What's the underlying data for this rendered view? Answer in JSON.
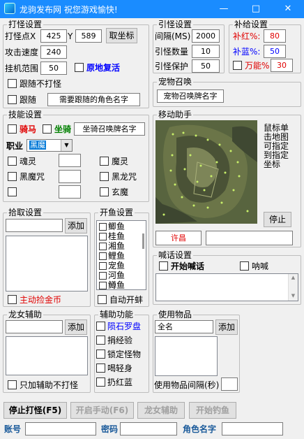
{
  "window": {
    "title": "龙驹发布网 祝您游戏愉快!",
    "min": "—",
    "max": "□",
    "close": "✕"
  },
  "attack": {
    "group": "打怪设置",
    "point_label": "打怪点X",
    "x": "425",
    "y_label": "Y",
    "y": "589",
    "get_coord": "取坐标",
    "speed_label": "攻击速度",
    "speed": "240",
    "range_label": "挂机范围",
    "range": "50",
    "revive_label": "原地复活",
    "follow_no_attack": "跟随不打怪",
    "follow_label": "跟随",
    "follow_name": "需要跟随的角色名字"
  },
  "pull": {
    "group": "引怪设置",
    "interval_label": "间隔(MS)",
    "interval": "2000",
    "count_label": "引怪数量",
    "count": "10",
    "protect_label": "引怪保护",
    "protect": "50"
  },
  "supply": {
    "group": "补给设置",
    "hp_label": "补红%:",
    "hp": "80",
    "mp_label": "补蓝%:",
    "mp": "50",
    "all_label": "万能%",
    "all": "30"
  },
  "pet": {
    "group": "宠物召唤",
    "name": "宠物召唤牌名字"
  },
  "skill": {
    "group": "技能设置",
    "horse": "骑马",
    "mount": "坐骑",
    "mount_name": "坐骑召唤牌名字",
    "job_label": "职业",
    "job": "黑魔",
    "items": [
      "魂灵",
      "魔灵",
      "黑魔咒",
      "黑龙咒",
      "",
      "玄魔"
    ]
  },
  "move": {
    "group": "移动助手",
    "hint": "鼠标单击地图可指定到指定坐标",
    "stop": "停止",
    "location": "许昌",
    "coord": ""
  },
  "pickup": {
    "group": "拾取设置",
    "add": "添加",
    "auto_gold": "主动捡金币"
  },
  "fish": {
    "group": "开鱼设置",
    "items": [
      "鲫鱼",
      "桂鱼",
      "湘鱼",
      "鲤鱼",
      "宠鱼",
      "河鱼",
      "鳟鱼"
    ],
    "auto_open": "自动开蚌"
  },
  "shout": {
    "group": "喊话设置",
    "start": "开始喊话",
    "yell": "呐喊"
  },
  "dragon": {
    "group": "龙女辅助",
    "add": "添加",
    "only_assist": "只加辅助不打怪"
  },
  "assist": {
    "group": "辅助功能",
    "items": [
      {
        "label": "陨石罗盘",
        "color": "#0000ff"
      },
      {
        "label": "捐经验",
        "color": "#000000"
      },
      {
        "label": "锁定怪物",
        "color": "#000000"
      },
      {
        "label": "喝轻身",
        "color": "#000000"
      },
      {
        "label": "扔红蓝",
        "color": "#000000"
      }
    ]
  },
  "use": {
    "group": "使用物品",
    "name": "全名",
    "add": "添加",
    "interval_label": "使用物品间隔(秒)"
  },
  "bottom": {
    "stop": "停止打怪(F5)",
    "hand": "开启手动(F6)",
    "dragon": "龙女辅助",
    "fish": "开始钓鱼"
  },
  "account": {
    "acc_label": "账号",
    "pwd_label": "密码",
    "role_label": "角色名字"
  }
}
